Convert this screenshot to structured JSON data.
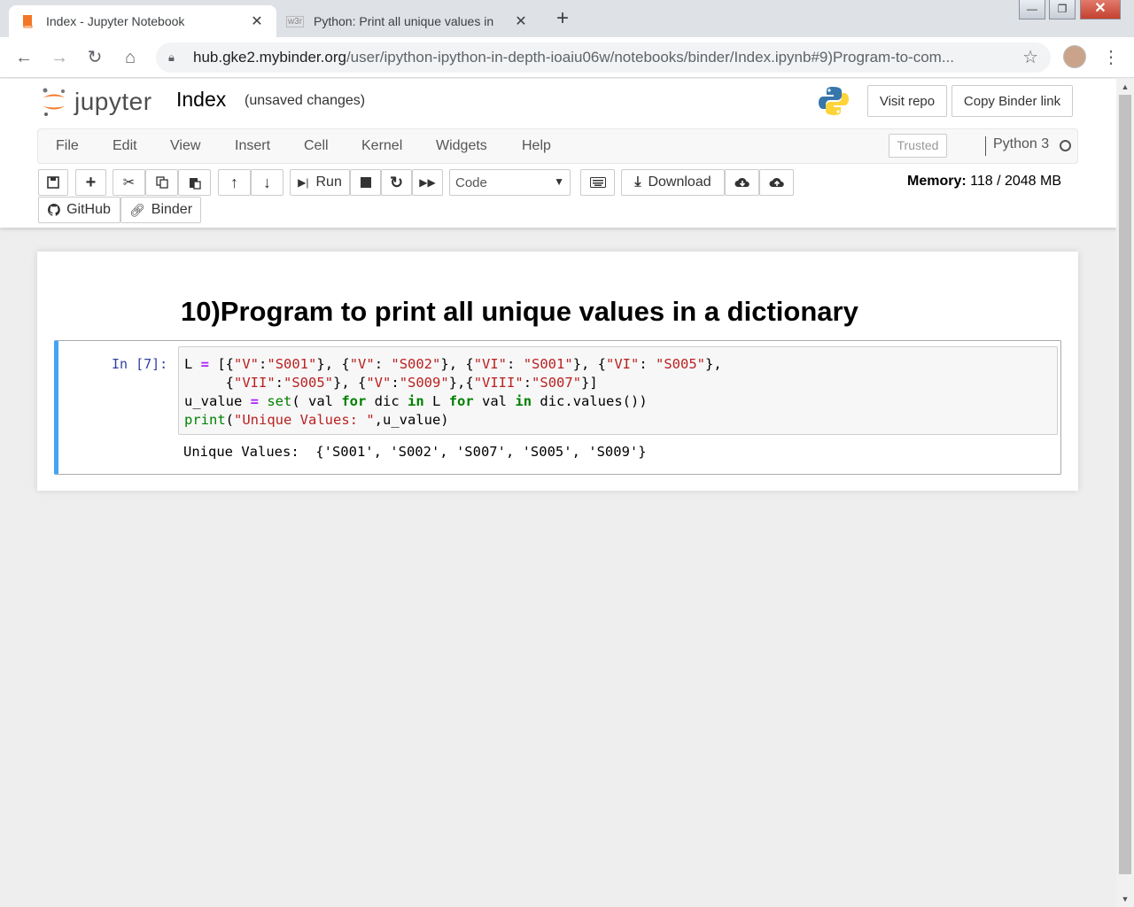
{
  "browser": {
    "tabs": [
      {
        "title": "Index - Jupyter Notebook",
        "favicon": "jupyter-book-icon",
        "active": true
      },
      {
        "title": "Python: Print all unique values in",
        "favicon": "w3r-icon",
        "active": false
      }
    ],
    "favicon_w3r_text": "w3r",
    "new_tab_symbol": "+",
    "url_host": "hub.gke2.mybinder.org",
    "url_path": "/user/ipython-ipython-in-depth-ioaiu06w/notebooks/binder/Index.ipynb#9)Program-to-com..."
  },
  "jupyter": {
    "logo_text": "jupyter",
    "notebook_name": "Index",
    "save_status": "(unsaved changes)",
    "header_buttons": {
      "visit_repo": "Visit repo",
      "copy_binder": "Copy Binder link"
    },
    "menu": [
      "File",
      "Edit",
      "View",
      "Insert",
      "Cell",
      "Kernel",
      "Widgets",
      "Help"
    ],
    "trusted": "Trusted",
    "kernel_name": "Python 3",
    "toolbar": {
      "run": "Run",
      "cell_type": "Code",
      "download": "Download",
      "github": "GitHub",
      "binder": "Binder"
    },
    "memory_label": "Memory:",
    "memory_value": "118 / 2048 MB"
  },
  "notebook": {
    "heading": "10)Program to print all unique values in a dictionary",
    "cell_prompt": "In [7]:",
    "output": "Unique Values:  {'S001', 'S002', 'S007', 'S005', 'S009'}"
  },
  "colors": {
    "cell_selected_border": "#42a5f5",
    "string": "#ba2121",
    "keyword": "#008000",
    "operator": "#aa22ff",
    "prompt": "#303f9f"
  }
}
